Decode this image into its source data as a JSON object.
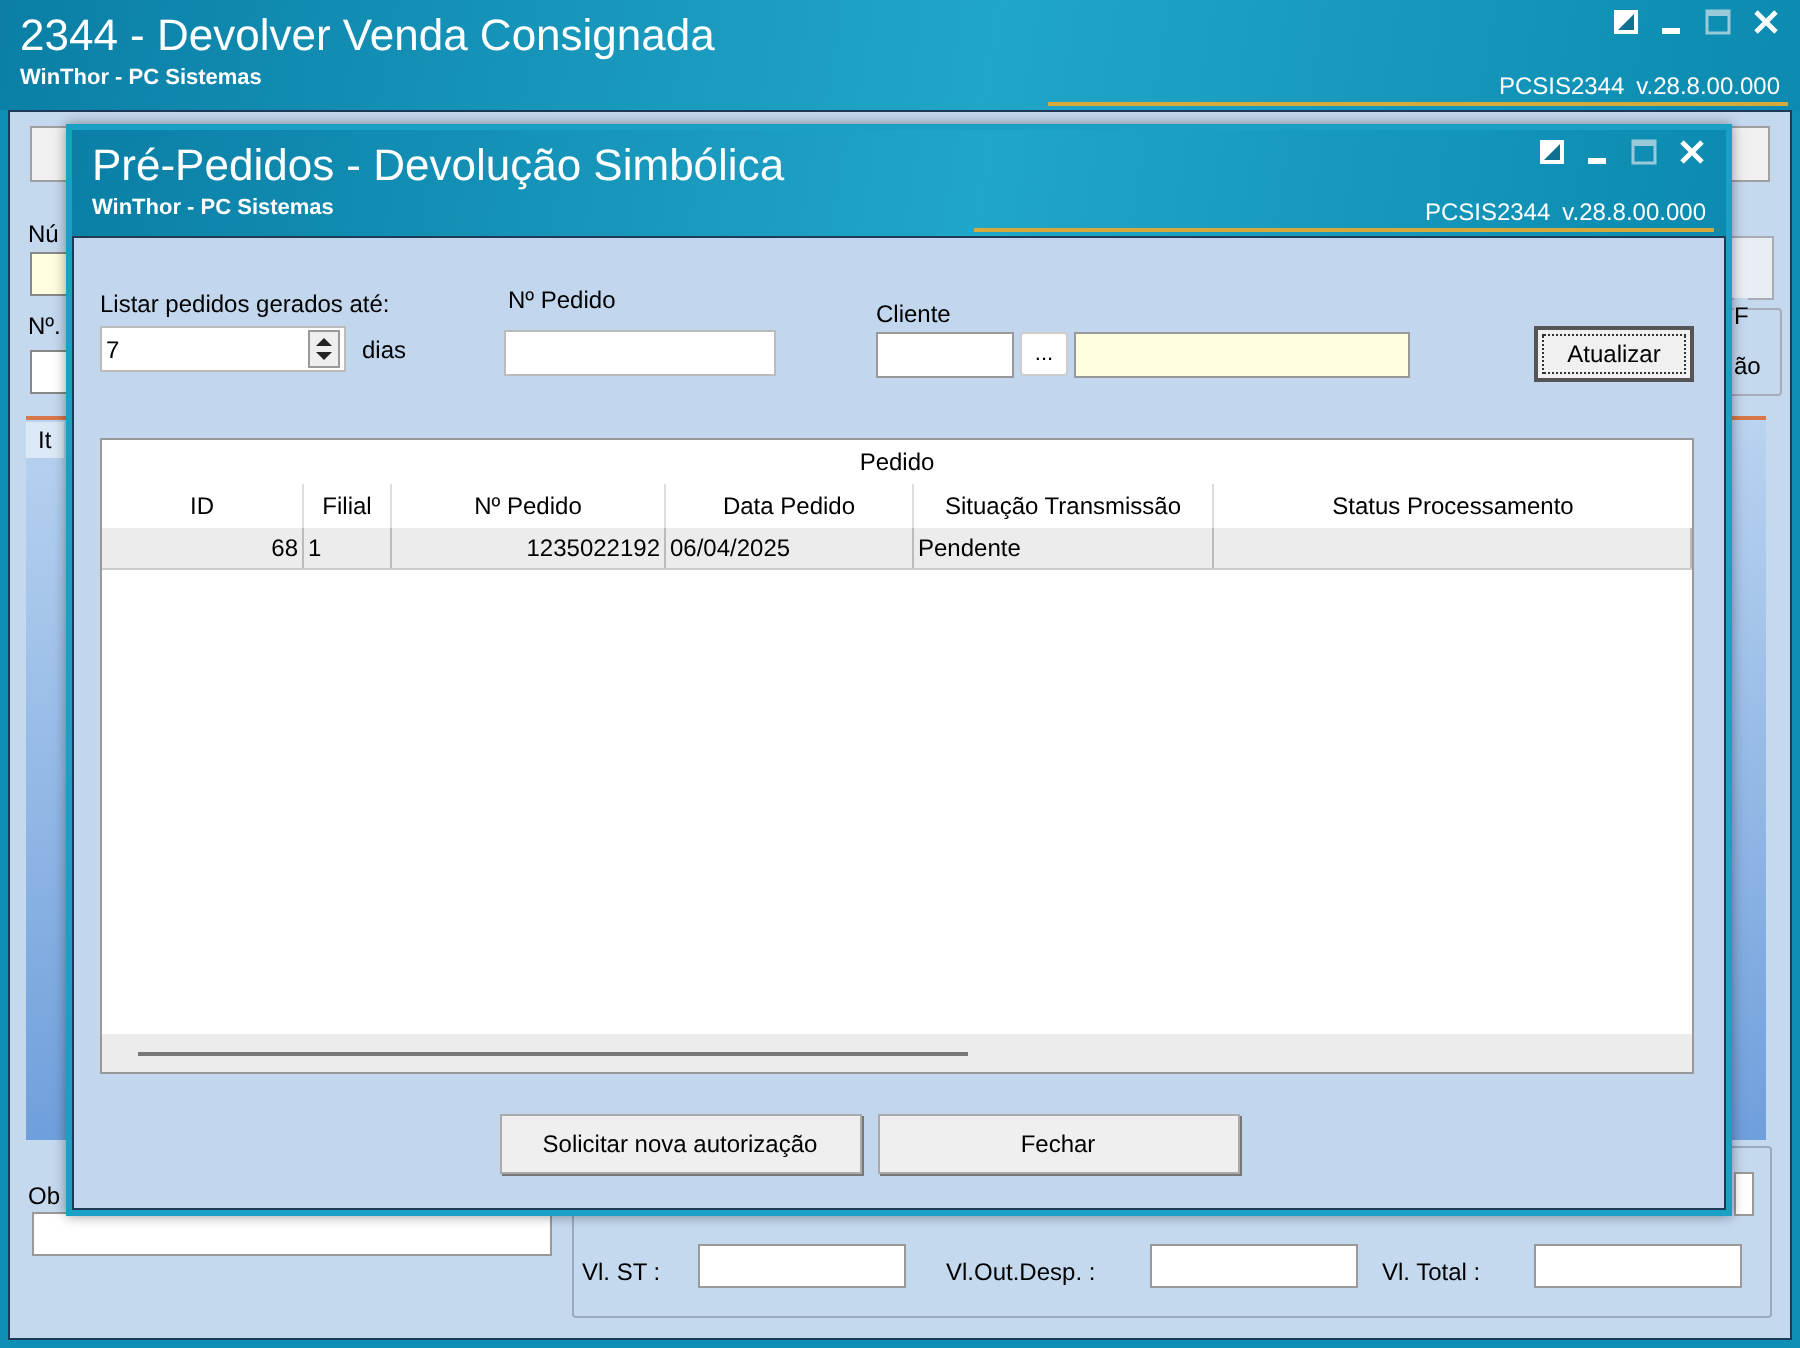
{
  "main_window": {
    "title": "2344 - Devolver Venda Consignada",
    "subtitle": "WinThor - PC Sistemas",
    "program_code": "PCSIS2344",
    "version": "v.28.8.00.000",
    "labels": [
      "Nú",
      "Nº.",
      "Ob"
    ],
    "tab_label": "It",
    "options_group": {
      "legend": "F",
      "option": "ão"
    },
    "totals": [
      {
        "label": "Vl. ST :"
      },
      {
        "label": "Vl.Out.Desp. :"
      },
      {
        "label": "Vl. Total :"
      }
    ]
  },
  "dialog": {
    "title": "Pré-Pedidos - Devolução Simbólica",
    "subtitle": "WinThor - PC Sistemas",
    "program_code": "PCSIS2344",
    "version": "v.28.8.00.000",
    "filters": {
      "days_label": "Listar pedidos gerados até:",
      "days_value": "7",
      "days_unit": "dias",
      "order_label": "Nº Pedido",
      "client_label": "Cliente",
      "lookup_button": "..."
    },
    "refresh_button": "Atualizar",
    "table": {
      "group_header": "Pedido",
      "columns": [
        {
          "label": "ID"
        },
        {
          "label": "Filial"
        },
        {
          "label": "Nº Pedido"
        },
        {
          "label": "Data Pedido"
        },
        {
          "label": "Situação Transmissão"
        },
        {
          "label": "Status Processamento"
        }
      ],
      "rows": [
        {
          "cells": [
            "68",
            "1",
            "1235022192",
            "06/04/2025",
            "Pendente"
          ]
        }
      ]
    },
    "buttons": [
      "Solicitar nova autorização",
      "Fechar"
    ]
  }
}
